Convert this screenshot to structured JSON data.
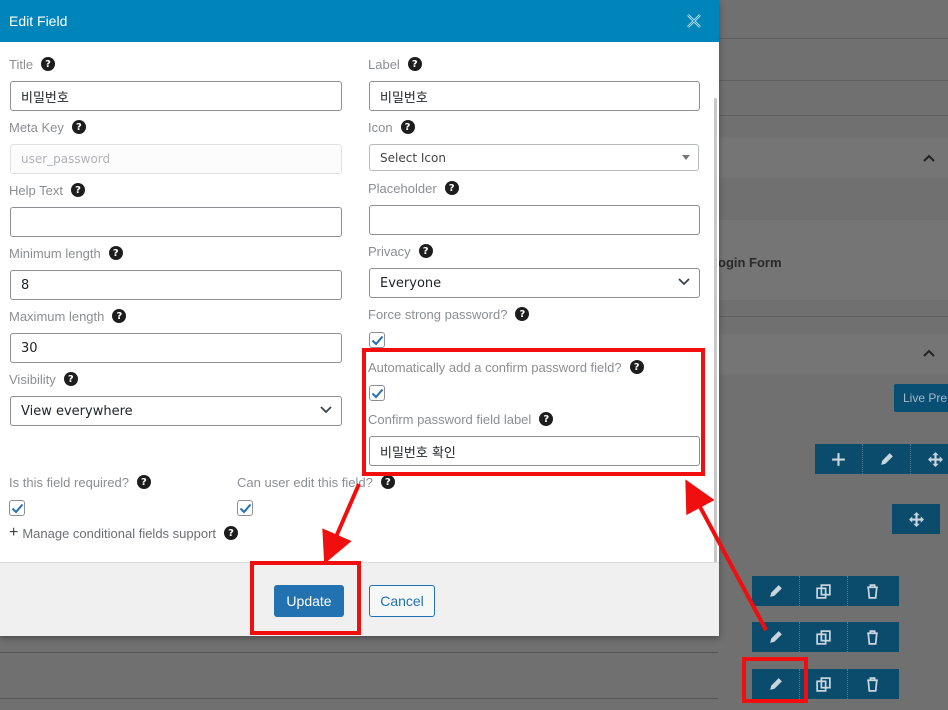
{
  "modal": {
    "title": "Edit Field",
    "close_icon": "close-icon",
    "left_fields": {
      "title": {
        "label": "Title",
        "value": "비밀번호"
      },
      "meta_key": {
        "label": "Meta Key",
        "placeholder": "user_password"
      },
      "help_text": {
        "label": "Help Text",
        "value": ""
      },
      "minimum_length": {
        "label": "Minimum length",
        "value": "8"
      },
      "maximum_length": {
        "label": "Maximum length",
        "value": "30"
      },
      "visibility": {
        "label": "Visibility",
        "value": "View everywhere"
      }
    },
    "right_fields": {
      "label": {
        "label": "Label",
        "value": "비밀번호"
      },
      "icon": {
        "label": "Icon",
        "value": "Select Icon"
      },
      "placeholder": {
        "label": "Placeholder",
        "value": ""
      },
      "privacy": {
        "label": "Privacy",
        "value": "Everyone"
      },
      "force_strong": {
        "label": "Force strong password?",
        "checked": true
      },
      "auto_confirm": {
        "label": "Automatically add a confirm password field?",
        "checked": true
      },
      "confirm_label": {
        "label": "Confirm password field label",
        "value": "비밀번호 확인"
      }
    },
    "required": {
      "label": "Is this field required?",
      "checked": true
    },
    "user_edit": {
      "label": "Can user edit this field?",
      "checked": true
    },
    "manage_conditional": "Manage conditional fields support",
    "help_glyph": "?",
    "plus_glyph": "+",
    "buttons": {
      "update": "Update",
      "cancel": "Cancel"
    }
  },
  "background": {
    "section_title": "ogin Form",
    "live_preview": "Live Pre",
    "toolbar_icons": [
      "plus-icon",
      "pencil-icon",
      "move-icon"
    ],
    "row_icons": [
      "pencil-icon",
      "duplicate-icon",
      "trash-icon"
    ]
  },
  "colors": {
    "header": "#0085ba",
    "primary_button": "#2271b1",
    "annotation": "#f00e0e",
    "toolbar": "#0b4c6d"
  }
}
